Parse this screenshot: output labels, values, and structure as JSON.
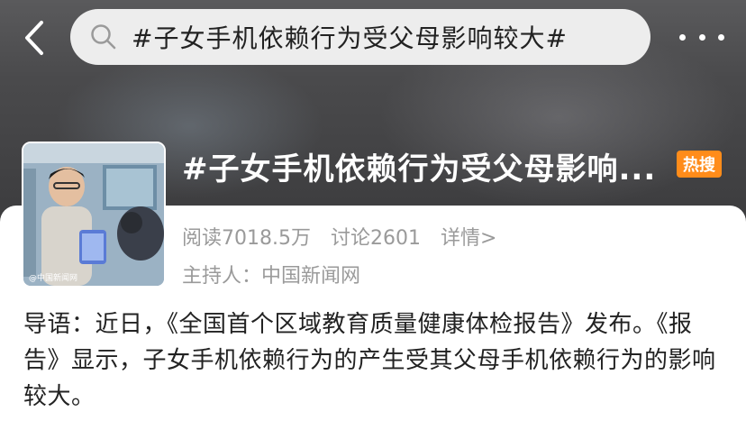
{
  "header": {
    "search_text": "#子女手机依赖行为受父母影响较大#"
  },
  "topic": {
    "title": "#子女手机依赖行为受父母影响...",
    "badge": "热搜",
    "reads": "阅读7018.5万",
    "discussions": "讨论2601",
    "details_link": "详情>",
    "host": "主持人：中国新闻网",
    "thumbnail_watermark": "@中国新闻网"
  },
  "intro": {
    "text": "导语：近日，《全国首个区域教育质量健康体检报告》发布。《报告》显示，子女手机依赖行为的产生受其父母手机依赖行为的影响较大。"
  },
  "colors": {
    "header_bg": "#4a4a4c",
    "hot_badge": "#ff8c1a",
    "meta_text": "#9a9a9a"
  }
}
